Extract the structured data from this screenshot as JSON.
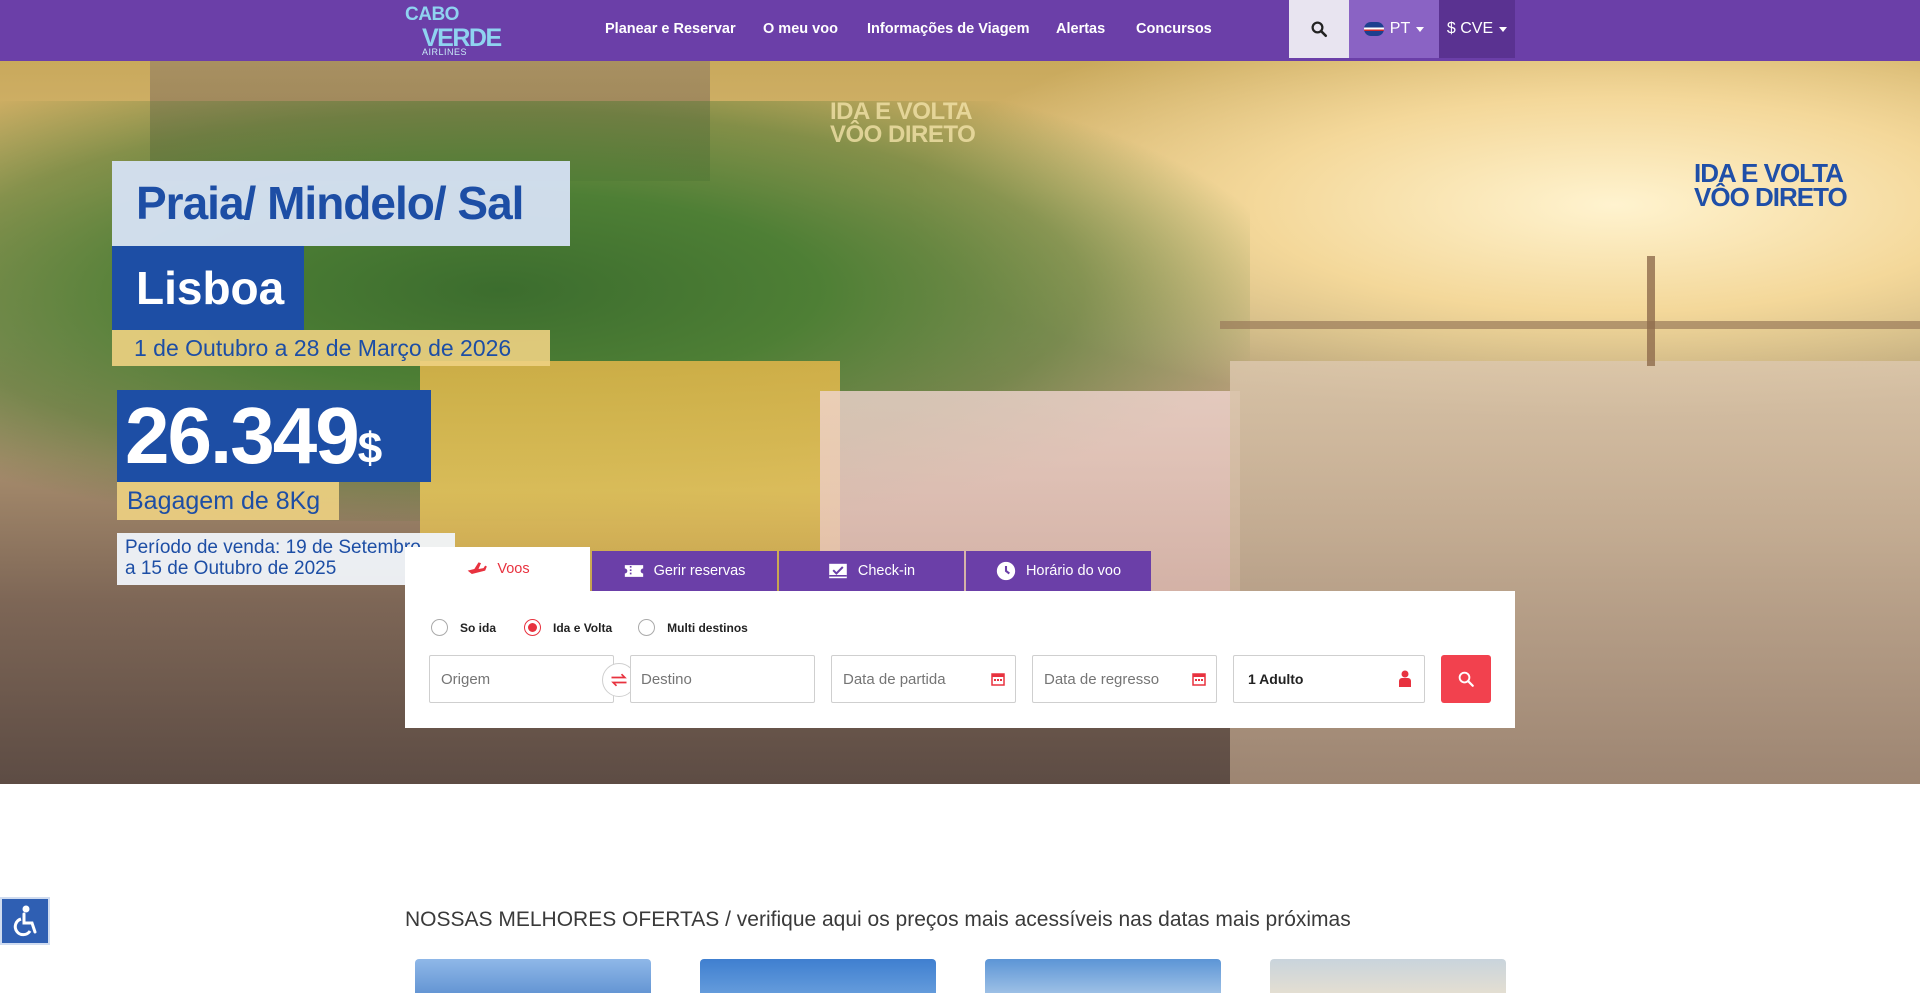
{
  "brand": {
    "logo_line1": "CABO",
    "logo_line2": "VERDE",
    "logo_line3": "AIRLINES"
  },
  "nav": {
    "items": [
      {
        "label": "Planear e Reservar"
      },
      {
        "label": "O meu voo"
      },
      {
        "label": "Informações de Viagem"
      },
      {
        "label": "Alertas"
      },
      {
        "label": "Concursos"
      }
    ],
    "language": "PT",
    "currency": "$ CVE"
  },
  "hero": {
    "promo_tag_top": [
      "IDA E VOLTA",
      "VÔO DIRETO"
    ],
    "promo_tag_right": [
      "IDA E VOLTA",
      "VÔO DIRETO"
    ],
    "routes": "Praia/ Mindelo/ Sal",
    "destination": "Lisboa",
    "dates": "1 de Outubro a 28 de Março de 2026",
    "price": "26.349",
    "price_currency": "$",
    "baggage": "Bagagem de 8Kg",
    "sale_period_line1": "Período de venda: 19 de Setembro",
    "sale_period_line2": "a 15 de Outubro de 2025"
  },
  "booking": {
    "tabs": [
      {
        "label": "Voos",
        "icon": "plane-icon",
        "active": true
      },
      {
        "label": "Gerir reservas",
        "icon": "ticket-icon",
        "active": false
      },
      {
        "label": "Check-in",
        "icon": "checkin-icon",
        "active": false
      },
      {
        "label": "Horário do voo",
        "icon": "clock-icon",
        "active": false
      }
    ],
    "trip_types": [
      {
        "label": "So ida",
        "selected": false
      },
      {
        "label": "Ida e Volta",
        "selected": true
      },
      {
        "label": "Multi destinos",
        "selected": false
      }
    ],
    "origin_placeholder": "Origem",
    "destination_placeholder": "Destino",
    "departure_placeholder": "Data de partida",
    "return_placeholder": "Data de regresso",
    "passengers": "1 Adulto"
  },
  "offers": {
    "title": "NOSSAS MELHORES OFERTAS / verifique aqui os preços mais acessíveis nas datas mais próximas"
  },
  "colors": {
    "header": "#6b3fa8",
    "accent": "#f2414e",
    "promo_blue": "#1d4ea5"
  }
}
